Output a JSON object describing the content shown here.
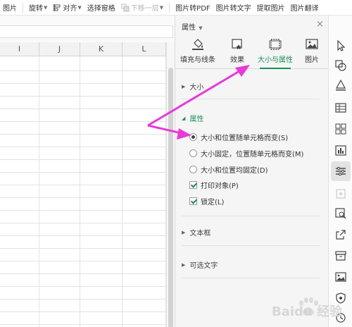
{
  "toolbar": {
    "items": [
      {
        "label": "图片",
        "disabled": false
      },
      {
        "label": "旋转",
        "disabled": false
      },
      {
        "label": "对齐",
        "disabled": false
      },
      {
        "label": "选择窗格",
        "disabled": false
      },
      {
        "label": "下移一层",
        "disabled": true
      },
      {
        "label": "图片转PDF",
        "disabled": false
      },
      {
        "label": "图片转文字",
        "disabled": false
      },
      {
        "label": "提取图片",
        "disabled": false
      },
      {
        "label": "图片翻译",
        "disabled": false
      }
    ]
  },
  "sheet": {
    "columns": [
      "I",
      "J",
      "K",
      "L"
    ]
  },
  "panel": {
    "title": "属性",
    "close": "×",
    "tabs": [
      {
        "label": "填充与线条",
        "icon": "fill-bucket-icon"
      },
      {
        "label": "效果",
        "icon": "effects-icon"
      },
      {
        "label": "大小与属性",
        "icon": "size-properties-icon",
        "active": true
      },
      {
        "label": "图片",
        "icon": "picture-icon"
      }
    ],
    "sections": {
      "size": "大小",
      "properties": "属性",
      "textbox": "文本框",
      "alt_text": "可选文字"
    },
    "radio_options": [
      {
        "label": "大小和位置随单元格而变(S)",
        "checked": true
      },
      {
        "label": "大小固定，位置随单元格而变(M)",
        "checked": false
      },
      {
        "label": "大小和位置均固定(D)",
        "checked": false
      }
    ],
    "checkboxes": [
      {
        "label": "打印对象(P)",
        "checked": true
      },
      {
        "label": "锁定(L)",
        "checked": true
      }
    ]
  },
  "rail": {
    "icons": [
      "pointer-icon",
      "shapes-icon",
      "fill-icon",
      "table-icon",
      "grid-icon",
      "bar-chart-icon",
      "adjust-icon",
      "sparkle-icon",
      "image-search-icon",
      "share-icon",
      "archive-icon",
      "image-icon",
      "shield-icon",
      "history-icon"
    ]
  },
  "watermark": {
    "text": "Baidu 经验"
  },
  "colors": {
    "accent": "#1a8f5a",
    "annotation": "#e83ad8"
  }
}
